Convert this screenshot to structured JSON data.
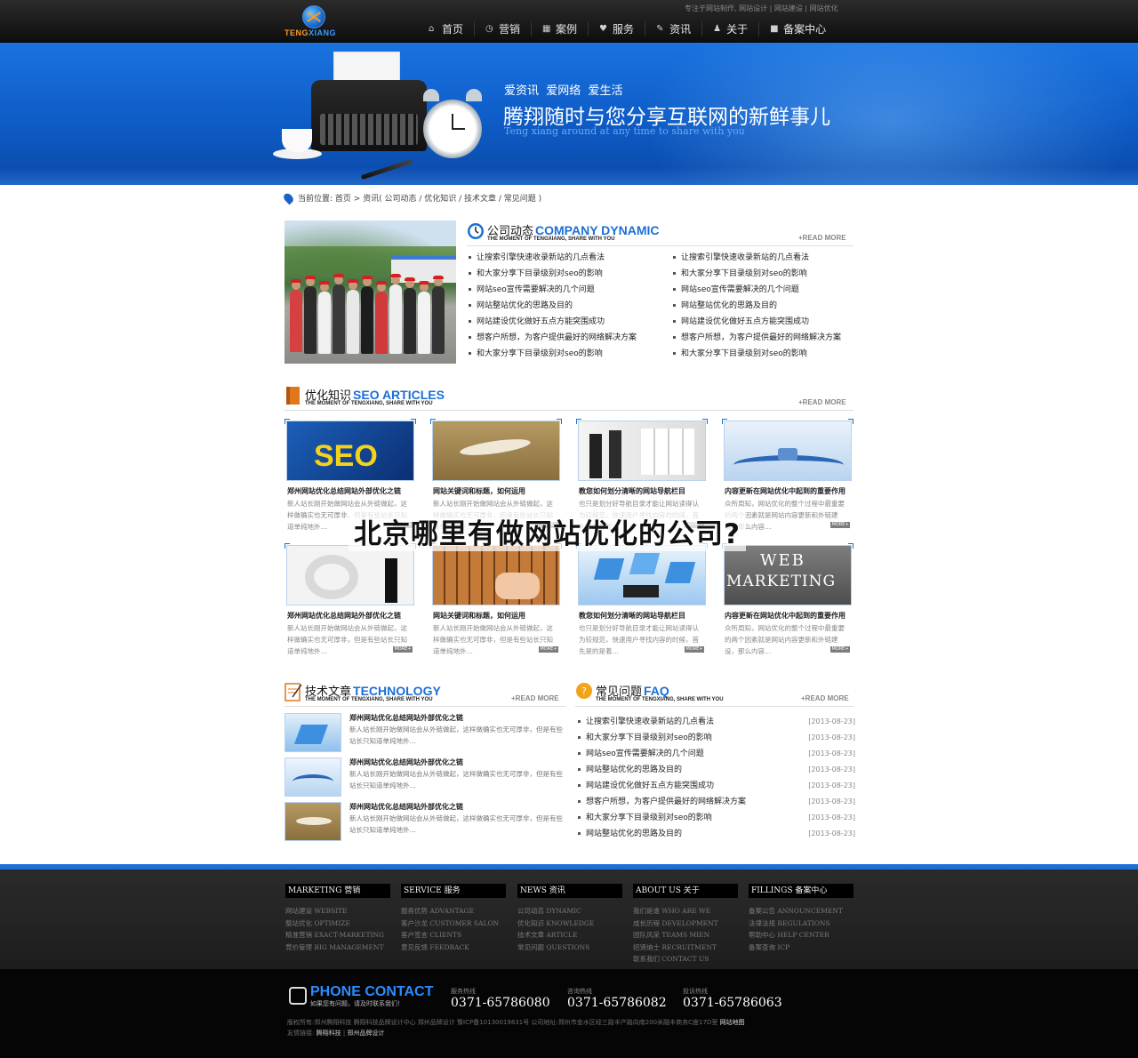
{
  "header": {
    "logo_text_a": "TENG",
    "logo_text_b": "XIANG",
    "top_links": "专注于网站制作, 网站设计 | 网站建设 | 网站优化",
    "nav": [
      {
        "label": "首页",
        "icon": "home-icon"
      },
      {
        "label": "营销",
        "icon": "clock-icon"
      },
      {
        "label": "案例",
        "icon": "grid-icon"
      },
      {
        "label": "服务",
        "icon": "heart-icon"
      },
      {
        "label": "资讯",
        "icon": "pencil-icon"
      },
      {
        "label": "关于",
        "icon": "user-icon"
      },
      {
        "label": "备案中心",
        "icon": "bag-icon"
      }
    ]
  },
  "banner": {
    "tagline": "爱资讯  爱网络  爱生活",
    "headline": "腾翔随时与您分享互联网的新鲜事儿",
    "subline": "Teng xiang around at any time to share with you"
  },
  "breadcrumb": "当前位置: 首页 > 资讯( 公司动态 / 优化知识 / 技术文章 / 常见问题 )",
  "company": {
    "cn": "公司动态",
    "en": "COMPANY DYNAMIC",
    "sub": "THE MOMENT OF TENGXIANG, SHARE WITH YOU",
    "more": "+READ MORE",
    "items_left": [
      "让搜索引擎快速收录新站的几点看法",
      "和大家分享下目录级别对seo的影响",
      "网站seo宣传需要解决的几个问题",
      "网站整站优化的思路及目的",
      "网站建设优化做好五点方能突围成功",
      "想客户所想，为客户提供最好的网络解决方案",
      "和大家分享下目录级别对seo的影响"
    ],
    "items_right": [
      "让搜索引擎快速收录新站的几点看法",
      "和大家分享下目录级别对seo的影响",
      "网站seo宣传需要解决的几个问题",
      "网站整站优化的思路及目的",
      "网站建设优化做好五点方能突围成功",
      "想客户所想，为客户提供最好的网络解决方案",
      "和大家分享下目录级别对seo的影响"
    ]
  },
  "seo": {
    "cn": "优化知识",
    "en": "SEO ARTICLES",
    "sub": "THE MOMENT OF TENGXIANG, SHARE WITH YOU",
    "more": "+READ MORE",
    "more_badge": "MORE+",
    "cards": [
      {
        "title": "郑州网站优化总结网站外部优化之链",
        "desc": "新人站长刚开始做网站会从外链做起，这样做确实也无可厚非，但是有些站长只知道单纯地外…"
      },
      {
        "title": "网站关键词和标题，如何运用",
        "desc": "新人站长刚开始做网站会从外链做起，这样做确实也无可厚非，但是有些站长只知道单纯地外…"
      },
      {
        "title": "教您如何划分清晰的网站导航栏目",
        "desc": "也只是划分好导航目录才能让网站读得认为较规范，快速用户寻找内容的时候，首先是的是着…"
      },
      {
        "title": "内容更新在网站优化中起到的重要作用",
        "desc": "众所周知，网站优化的整个过程中最重要的两个因素就是网站内容更新和外链建设，那么内容…"
      },
      {
        "title": "郑州网站优化总结网站外部优化之链",
        "desc": "新人站长刚开始做网站会从外链做起，这样做确实也无可厚非，但是有些站长只知道单纯地外…"
      },
      {
        "title": "网站关键词和标题，如何运用",
        "desc": "新人站长刚开始做网站会从外链做起，这样做确实也无可厚非，但是有些站长只知道单纯地外…"
      },
      {
        "title": "教您如何划分清晰的网站导航栏目",
        "desc": "也只是划分好导航目录才能让网站读得认为较规范，快速用户寻找内容的时候，首先是的是着…"
      },
      {
        "title": "内容更新在网站优化中起到的重要作用",
        "desc": "众所周知，网站优化的整个过程中最重要的两个因素就是网站内容更新和外链建设，那么内容…"
      }
    ]
  },
  "overlay_title": "北京哪里有做网站优化的公司?",
  "technology": {
    "cn": "技术文章",
    "en": "TECHNOLOGY",
    "sub": "THE MOMENT OF TENGXIANG, SHARE WITH YOU",
    "more": "+READ MORE",
    "items": [
      {
        "title": "郑州网站优化总结网站外部优化之链",
        "desc": "新人站长刚开始做网站会从外链做起，这样做确实也无可厚非，但是有些站长只知道单纯地外…"
      },
      {
        "title": "郑州网站优化总结网站外部优化之链",
        "desc": "新人站长刚开始做网站会从外链做起，这样做确实也无可厚非，但是有些站长只知道单纯地外…"
      },
      {
        "title": "郑州网站优化总结网站外部优化之链",
        "desc": "新人站长刚开始做网站会从外链做起，这样做确实也无可厚非，但是有些站长只知道单纯地外…"
      }
    ]
  },
  "faq": {
    "cn": "常见问题",
    "en": "FAQ",
    "sub": "THE MOMENT OF TENGXIANG, SHARE WITH YOU",
    "more": "+READ MORE",
    "items": [
      {
        "text": "让搜索引擎快速收录新站的几点看法",
        "date": "[2013-08-23]"
      },
      {
        "text": "和大家分享下目录级别对seo的影响",
        "date": "[2013-08-23]"
      },
      {
        "text": "网站seo宣传需要解决的几个问题",
        "date": "[2013-08-23]"
      },
      {
        "text": "网站整站优化的思路及目的",
        "date": "[2013-08-23]"
      },
      {
        "text": "网站建设优化做好五点方能突围成功",
        "date": "[2013-08-23]"
      },
      {
        "text": "想客户所想，为客户提供最好的网络解决方案",
        "date": "[2013-08-23]"
      },
      {
        "text": "和大家分享下目录级别对seo的影响",
        "date": "[2013-08-23]"
      },
      {
        "text": "网站整站优化的思路及目的",
        "date": "[2013-08-23]"
      }
    ]
  },
  "footer": {
    "columns": [
      {
        "title": "MARKETING 营销",
        "items": [
          "网站建设  WEBSITE",
          "整站优化  OPTIMIZE",
          "精准营销  EXACT-MARKETING",
          "竞价管理  BIG MANAGEMENT"
        ]
      },
      {
        "title": "SERVICE 服务",
        "items": [
          "服务优势  ADVANTAGE",
          "客户沙龙  CUSTOMER SALON",
          "客户签言  CLIENTS",
          "意见反馈  FEEDBACK"
        ]
      },
      {
        "title": "NEWS 资讯",
        "items": [
          "公司动态  DYNAMIC",
          "优化知识  KNOWLEDGE",
          "技术文章  ARTICLE",
          "常见问题  QUESTIONS"
        ]
      },
      {
        "title": "ABOUT US 关于",
        "items": [
          "我们是谁 WHO ARE WE",
          "成长历程 DEVELOPMENT",
          "团队风采 TEAMS MIEN",
          "招贤纳士 RECRUITMENT",
          "联系我们 CONTACT US"
        ]
      },
      {
        "title": "FILLINGS 备案中心",
        "items": [
          "备案公告  ANNOUNCEMENT",
          "法律法规  REGULATIONS",
          "帮助中心  HELP CENTER",
          "备案查询  ICP"
        ]
      }
    ],
    "phone_title": "PHONE CONTACT",
    "phone_sub": "如果您有问题，请及时联系我们！",
    "phones": [
      {
        "label": "服务热线",
        "number": "0371-65786080"
      },
      {
        "label": "咨询热线",
        "number": "0371-65786082"
      },
      {
        "label": "投诉热线",
        "number": "0371-65786063"
      }
    ],
    "copyright": "版权所有:郑州腾翔科技  腾翔科技品牌设计中心  郑州品牌设计    豫ICP备10130019831号    公司地址:郑州市金水区经三路丰产路向南200米融丰商务C座17D室",
    "sitemap": "网站地图",
    "friend_label": "友情链接:",
    "friend_a": "腾翔科技",
    "friend_b": "郑州品牌设计"
  }
}
